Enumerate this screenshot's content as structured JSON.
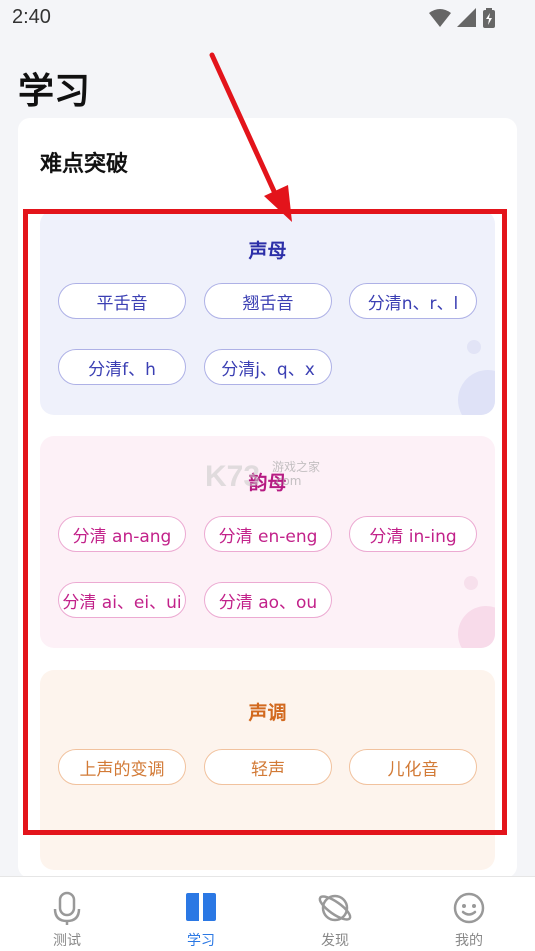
{
  "status_bar": {
    "time": "2:40",
    "icons": [
      "wifi-icon",
      "signal-icon",
      "battery-icon"
    ]
  },
  "page": {
    "title": "学习"
  },
  "card": {
    "title": "难点突破",
    "sections": [
      {
        "title": "声母",
        "chips": [
          "平舌音",
          "翘舌音",
          "分清n、r、l",
          "分清f、h",
          "分清j、q、x"
        ]
      },
      {
        "title": "韵母",
        "chips": [
          "分清 an-ang",
          "分清 en-eng",
          "分清 in-ing",
          "分清 ai、ei、ui",
          "分清 ao、ou"
        ]
      },
      {
        "title": "声调",
        "chips": [
          "上声的变调",
          "轻声",
          "儿化音"
        ]
      }
    ]
  },
  "watermark": {
    "text": "K73",
    "sub": "游戏之家\n.com"
  },
  "bottom_nav": {
    "items": [
      {
        "label": "测试",
        "icon": "microphone-icon",
        "active": false
      },
      {
        "label": "学习",
        "icon": "book-icon",
        "active": true
      },
      {
        "label": "发现",
        "icon": "planet-icon",
        "active": false
      },
      {
        "label": "我的",
        "icon": "face-icon",
        "active": false
      }
    ]
  },
  "colors": {
    "annotation_red": "#e3141b",
    "active_blue": "#2b78e4",
    "shengmu_text": "#2c2fa8",
    "yunmu_text": "#b61a82",
    "shengdiao_text": "#d2691e"
  }
}
